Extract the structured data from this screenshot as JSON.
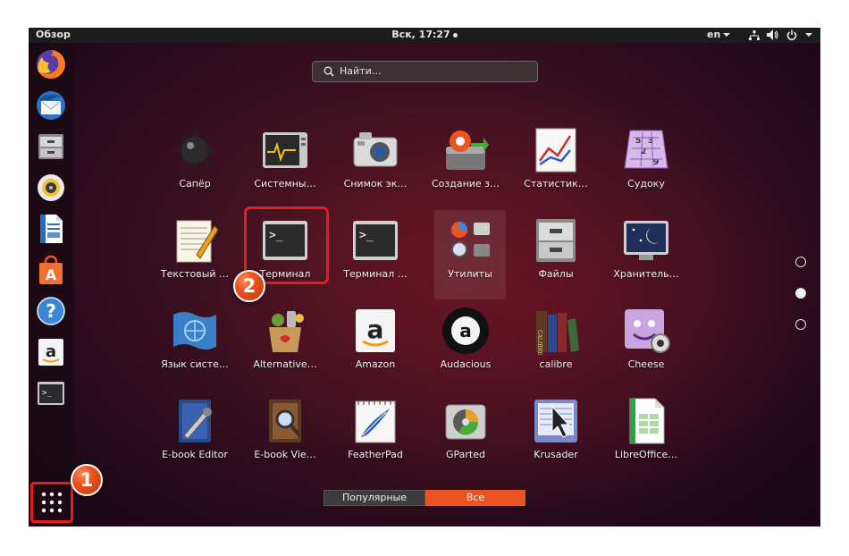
{
  "topbar": {
    "activities": "Обзор",
    "clock": "Вск, 17:27",
    "language": "en",
    "icons": [
      "network-icon",
      "volume-icon",
      "power-icon",
      "system-menu-arrow-icon"
    ]
  },
  "dock": {
    "items": [
      "firefox-icon",
      "thunderbird-icon",
      "files-icon",
      "rhythmbox-icon",
      "writer-icon",
      "software-center-icon",
      "help-icon",
      "amazon-icon",
      "terminal-icon"
    ],
    "show_apps_icon": "grid-icon"
  },
  "search": {
    "placeholder": "Найти…"
  },
  "apps": [
    {
      "label": "Сапёр",
      "icon": "mines-icon"
    },
    {
      "label": "Системны…",
      "icon": "system-monitor-icon"
    },
    {
      "label": "Снимок эк…",
      "icon": "screenshot-icon"
    },
    {
      "label": "Создание з…",
      "icon": "startup-disk-creator-icon"
    },
    {
      "label": "Статистик…",
      "icon": "statistics-icon"
    },
    {
      "label": "Судоку",
      "icon": "sudoku-icon"
    },
    {
      "label": "Текстовый …",
      "icon": "text-editor-icon"
    },
    {
      "label": "Терминал",
      "icon": "terminal-icon"
    },
    {
      "label": "Терминал …",
      "icon": "terminal-icon"
    },
    {
      "label": "Утилиты",
      "icon": "utilities-folder-icon"
    },
    {
      "label": "Файлы",
      "icon": "files-icon"
    },
    {
      "label": "Хранитель…",
      "icon": "screensaver-icon"
    },
    {
      "label": "Язык систе…",
      "icon": "language-support-icon"
    },
    {
      "label": "Alternative…",
      "icon": "alternatives-icon"
    },
    {
      "label": "Amazon",
      "icon": "amazon-icon"
    },
    {
      "label": "Audacious",
      "icon": "audacious-icon"
    },
    {
      "label": "calibre",
      "icon": "calibre-icon"
    },
    {
      "label": "Cheese",
      "icon": "cheese-icon"
    },
    {
      "label": "E-book Editor",
      "icon": "ebook-editor-icon"
    },
    {
      "label": "E-book Vie…",
      "icon": "ebook-viewer-icon"
    },
    {
      "label": "FeatherPad",
      "icon": "featherpad-icon"
    },
    {
      "label": "GParted",
      "icon": "gparted-icon"
    },
    {
      "label": "Krusader",
      "icon": "krusader-icon"
    },
    {
      "label": "LibreOffice…",
      "icon": "libreoffice-calc-icon"
    }
  ],
  "page_indicators": [
    {
      "active": false
    },
    {
      "active": true
    },
    {
      "active": false
    }
  ],
  "view_tabs": {
    "frequent": "Популярные",
    "all": "Все",
    "active": "all"
  },
  "annotations": {
    "step1": "1",
    "step2": "2",
    "highlight_color": "#e41e1e"
  },
  "colors": {
    "accent": "#e95420",
    "panel": "#1c1c1c"
  }
}
